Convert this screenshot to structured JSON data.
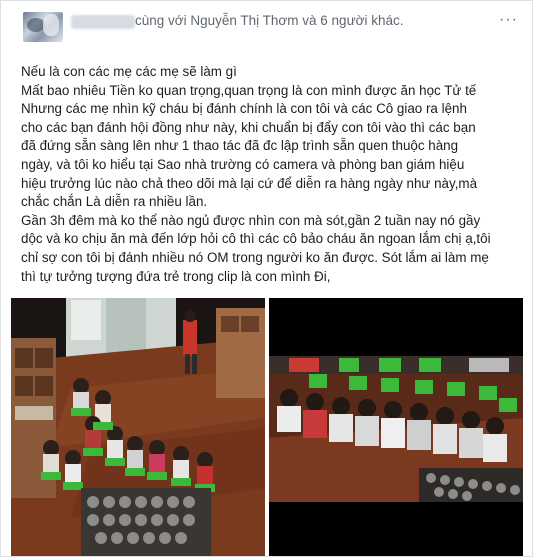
{
  "post": {
    "tagline": "cùng với Nguyễn Thị Thơm và 6 người khác.",
    "more_label": "···",
    "lines": [
      "Nếu là con các mẹ các mẹ sẽ làm gì",
      "Mất bao nhiêu Tiền ko quan trọng,quan trọng là con mình được ăn học Tử tế",
      "Nhưng các mẹ nhìn kỹ cháu bị đánh chính là con tôi và các Cô giao ra lệnh",
      "cho các bạn đánh hội đồng như này, khi chuẩn bị đẩy con tôi vào thì các bạn",
      "đã đứng sẵn sàng lên như 1 thao tác đã đc lập trình sẵn quen thuộc hàng",
      "ngày, và tôi ko hiểu tại Sao nhà trường có camera và phòng ban giám hiệu",
      "hiệu trưởng lúc nào chả theo dõi mà lại cứ để diễn ra hàng ngày như này,mà",
      "chắc chắn Là diễn ra nhiều lần.",
      "Gần 3h đêm mà ko thể nào ngủ được nhìn con mà sót,gần 2 tuần nay nó gầy",
      "dộc và ko chịu ăn mà đến lớp hỏi cô thì các cô bảo cháu ăn ngoan lắm chị ạ,tôi",
      "chỉ sợ con tôi bị đánh nhiều nó OM trong người ko ăn được. Sót lắm ai làm mẹ",
      "thì tự tưởng tượng đứa trẻ trong clip là con mình Đi,"
    ]
  },
  "colors": {
    "text": "#1c1e21",
    "meta": "#606770",
    "border": "#dddfe2",
    "chair_green": "#3cb83a",
    "floor_brown": "#7a3a1e"
  }
}
